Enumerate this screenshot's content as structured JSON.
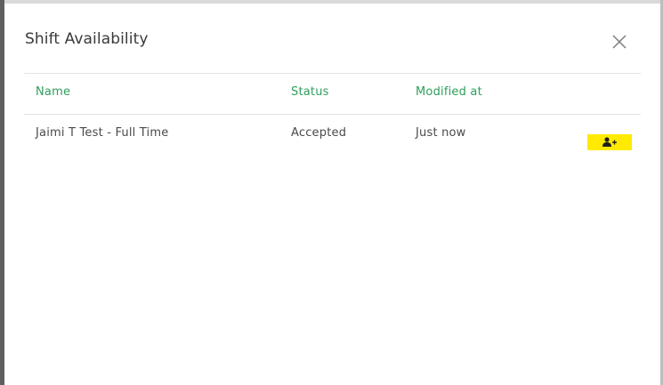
{
  "modal": {
    "title": "Shift Availability",
    "close_icon": "close-icon"
  },
  "table": {
    "columns": [
      "Name",
      "Status",
      "Modified at"
    ],
    "rows": [
      {
        "name": "Jaimi T Test - Full Time",
        "status": "Accepted",
        "modified_at": "Just now",
        "action_icon": "add-user-icon"
      }
    ]
  },
  "colors": {
    "header_text": "#2e9e5b",
    "action_button": "#ffea00"
  }
}
